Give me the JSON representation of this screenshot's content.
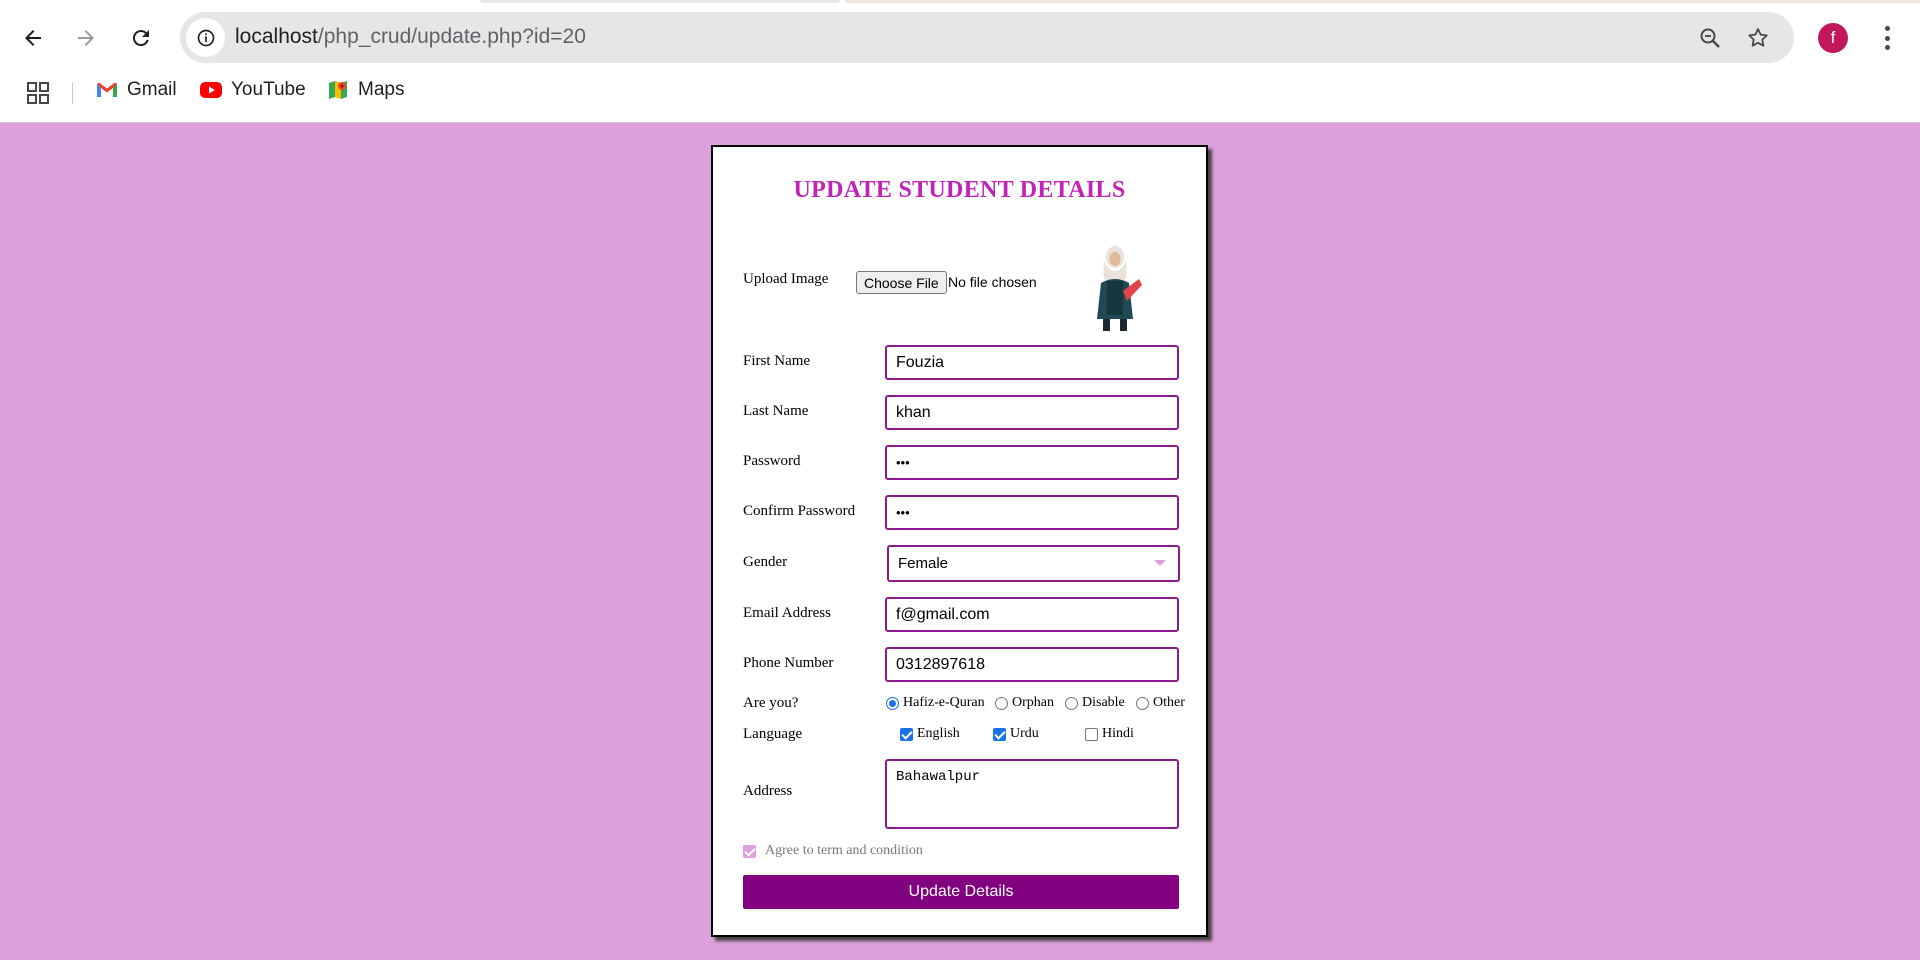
{
  "browser": {
    "url_host": "localhost",
    "url_path": "/php_crud/update.php?id=20",
    "avatar_letter": "f",
    "bookmarks": [
      {
        "label": "Gmail",
        "icon": "gmail-icon"
      },
      {
        "label": "YouTube",
        "icon": "youtube-icon"
      },
      {
        "label": "Maps",
        "icon": "maps-icon"
      }
    ]
  },
  "form": {
    "title": "UPDATE STUDENT DETAILS",
    "upload_label": "Upload Image",
    "choose_file": "Choose File",
    "no_file": "No file chosen",
    "first_name_label": "First Name",
    "first_name": "Fouzia",
    "last_name_label": "Last Name",
    "last_name": "khan",
    "password_label": "Password",
    "password_mask": "•••",
    "confirm_label": "Confirm Password",
    "confirm_mask": "•••",
    "gender_label": "Gender",
    "gender": "Female",
    "email_label": "Email Address",
    "email": "f@gmail.com",
    "phone_label": "Phone Number",
    "phone": "0312897618",
    "are_you_label": "Are you?",
    "are_you_options": [
      "Hafiz-e-Quran",
      "Orphan",
      "Disable",
      "Other"
    ],
    "are_you_selected": "Hafiz-e-Quran",
    "language_label": "Language",
    "languages": [
      {
        "label": "English",
        "checked": true
      },
      {
        "label": "Urdu",
        "checked": true
      },
      {
        "label": "Hindi",
        "checked": false
      }
    ],
    "address_label": "Address",
    "address": "Bahawalpur",
    "agree_label": "Agree to term and condition",
    "agree_checked": true,
    "submit_label": "Update Details"
  },
  "colors": {
    "page_bg": "#dda0dd",
    "title": "#c023b8",
    "field_border": "#8b1a8b",
    "button": "#800080"
  }
}
